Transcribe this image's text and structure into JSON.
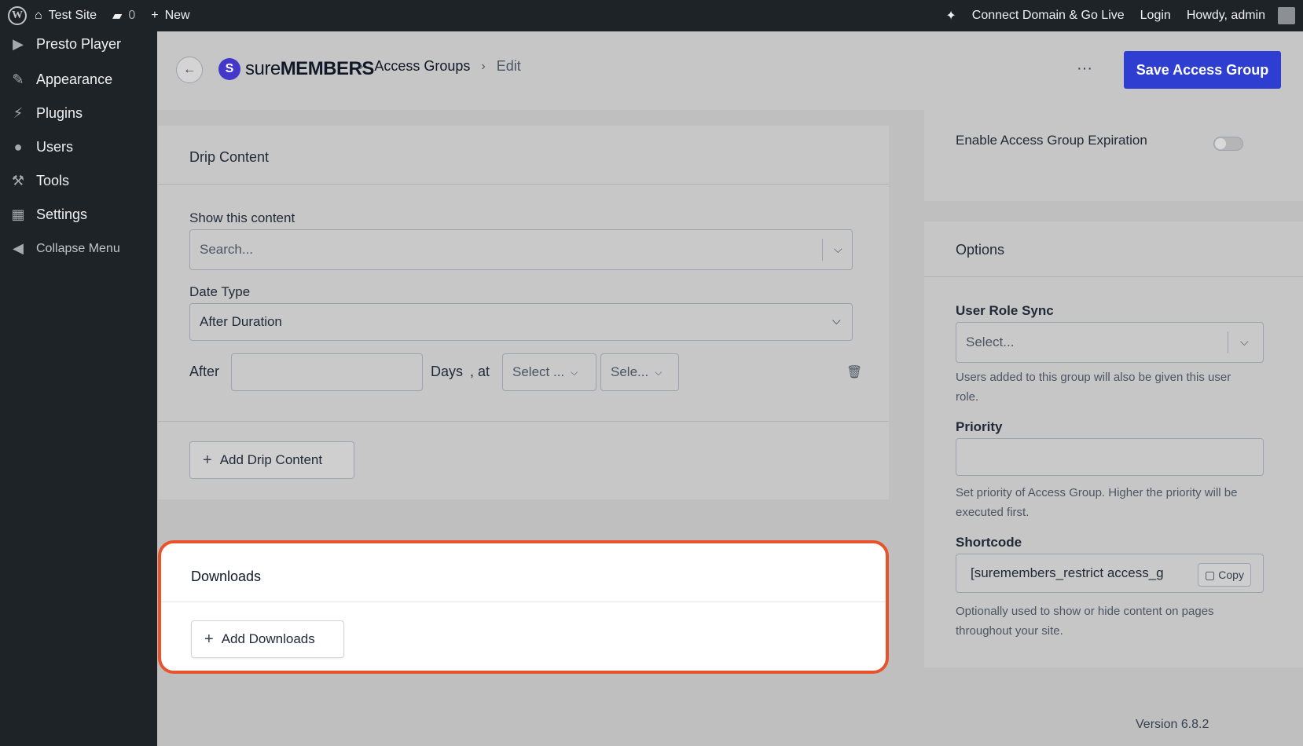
{
  "admin_bar": {
    "site_name": "Test Site",
    "comments_count": "0",
    "new_label": "New",
    "connect_label": "Connect Domain & Go Live",
    "login_label": "Login",
    "howdy_label": "Howdy, admin"
  },
  "sidebar": {
    "items": [
      {
        "label": "Presto Player",
        "icon": "play-icon"
      },
      {
        "label": "Appearance",
        "icon": "brush-icon"
      },
      {
        "label": "Plugins",
        "icon": "plug-icon"
      },
      {
        "label": "Users",
        "icon": "user-icon"
      },
      {
        "label": "Tools",
        "icon": "wrench-icon"
      },
      {
        "label": "Settings",
        "icon": "settings-icon"
      },
      {
        "label": "Collapse Menu",
        "icon": "collapse-icon"
      }
    ]
  },
  "header": {
    "brand_light": "sure",
    "brand_bold": "MEMBERS",
    "breadcrumb_parent": "Access Groups",
    "breadcrumb_current": "Edit",
    "more_label": "···",
    "save_label": "Save Access Group"
  },
  "drip": {
    "title": "Drip Content",
    "show_label": "Show this content",
    "show_placeholder": "Search...",
    "date_type_label": "Date Type",
    "date_type_value": "After Duration",
    "after_label": "After",
    "days_label": "Days",
    "at_label": ", at",
    "hour_placeholder": "Select ...",
    "minute_placeholder": "Sele...",
    "add_label": "Add Drip Content"
  },
  "downloads": {
    "title": "Downloads",
    "add_label": "Add Downloads",
    "highlight_color": "#e8532e"
  },
  "expiration": {
    "label": "Enable Access Group Expiration",
    "enabled": false
  },
  "options": {
    "title": "Options",
    "role_sync_label": "User Role Sync",
    "role_sync_placeholder": "Select...",
    "role_sync_help": "Users added to this group will also be given this user role.",
    "priority_label": "Priority",
    "priority_help": "Set priority of Access Group. Higher the priority will be executed first.",
    "shortcode_label": "Shortcode",
    "shortcode_value": "[suremembers_restrict access_g",
    "copy_label": "Copy",
    "shortcode_help": "Optionally used to show or hide content on pages throughout your site."
  },
  "footer": {
    "version": "Version 6.8.2"
  },
  "colors": {
    "accent": "#2d3ed0",
    "admin_bar": "#1d2327"
  }
}
